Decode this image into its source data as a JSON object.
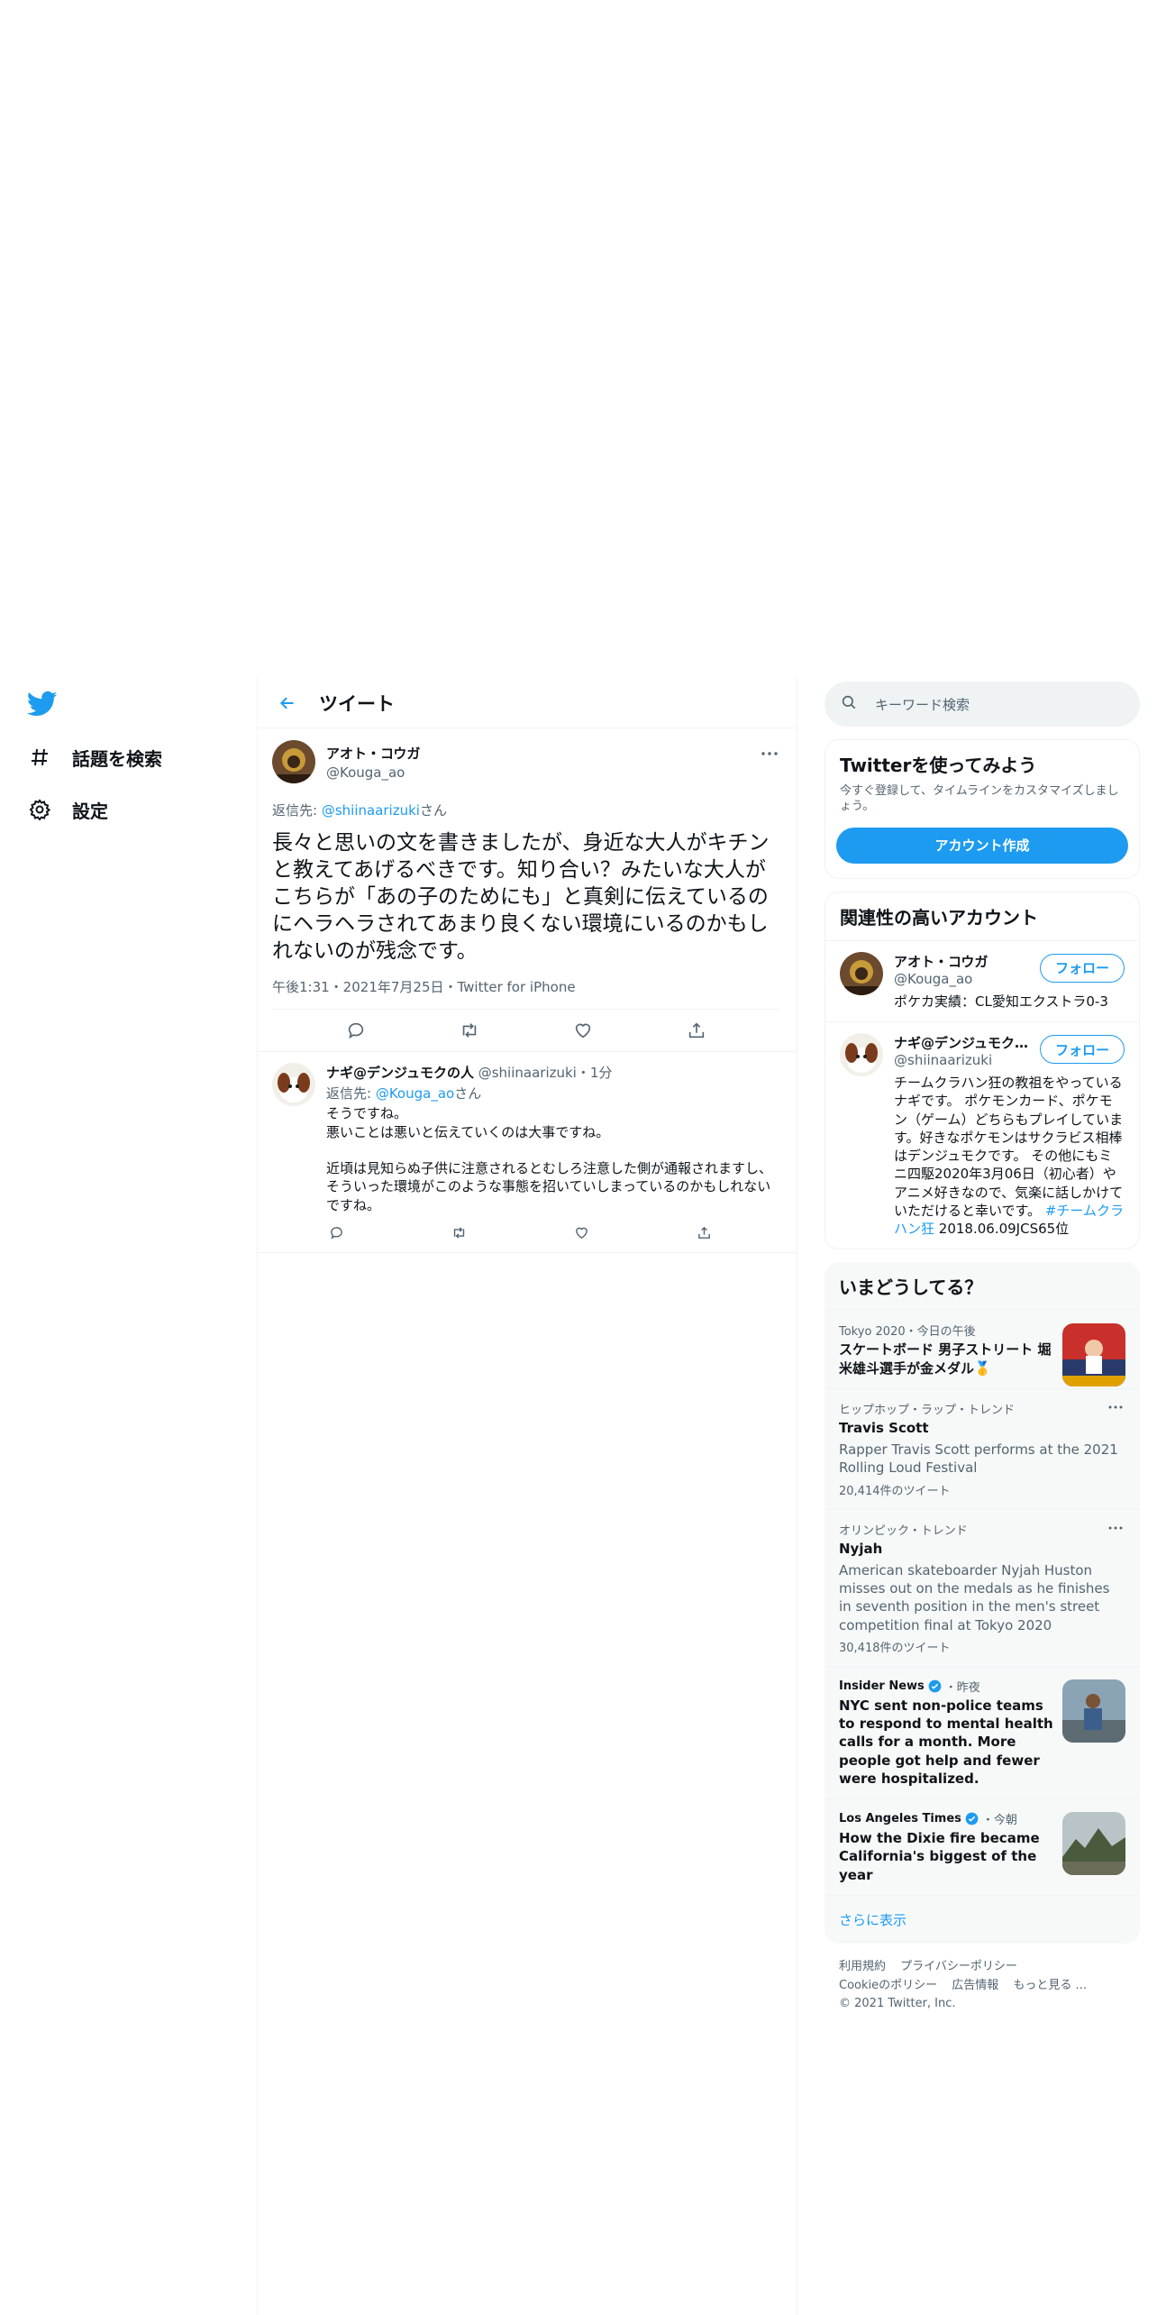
{
  "nav": {
    "items": [
      {
        "label": "話題を検索",
        "icon": "hashtag-icon"
      },
      {
        "label": "設定",
        "icon": "gear-icon"
      }
    ]
  },
  "header": {
    "title": "ツイート"
  },
  "main_tweet": {
    "display_name": "アオト・コウガ",
    "handle": "@Kouga_ao",
    "reply_prefix": "返信先: ",
    "reply_to": "@shiinaarizuki",
    "reply_suffix": "さん",
    "text": "長々と思いの文を書きましたが、身近な大人がキチンと教えてあげるべきです。知り合い？みたいな大人がこちらが「あの子のためにも」と真剣に伝えているのにヘラヘラされてあまり良くない環境にいるのかもしれないのが残念です。",
    "timestamp": "午後1:31・2021年7月25日・Twitter for iPhone"
  },
  "reply_tweet": {
    "display_name": "ナギ@デンジュモクの人",
    "handle": "@shiinaarizuki",
    "time": "・1分",
    "reply_prefix": "返信先: ",
    "reply_to": "@Kouga_ao",
    "reply_suffix": "さん",
    "text": "そうですね。\n悪いことは悪いと伝えていくのは大事ですね。\n\n近頃は見知らぬ子供に注意されるとむしろ注意した側が通報されますし、そういった環境がこのような事態を招いていしまっているのかもしれないですね。"
  },
  "search": {
    "placeholder": "キーワード検索"
  },
  "signup": {
    "title": "Twitterを使ってみよう",
    "subtitle": "今すぐ登録して、タイムラインをカスタマイズしましょう。",
    "button": "アカウント作成"
  },
  "relevant": {
    "title": "関連性の高いアカウント",
    "follow_label": "フォロー",
    "accounts": [
      {
        "display_name": "アオト・コウガ",
        "handle": "@Kouga_ao",
        "bio": "ポケカ実績：CL愛知エクストラ0-3"
      },
      {
        "display_name": "ナギ@デンジュモクの人",
        "handle": "@shiinaarizuki",
        "bio": "チームクラハン狂の教祖をやっているナギです。 ポケモンカード、ポケモン（ゲーム）どちらもプレイしています。好きなポケモンはサクラビス相棒はデンジュモクです。 その他にもミニ四駆2020年3月06日（初心者）やアニメ好きなので、気楽に話しかけていただけると幸いです。",
        "bio_tag": "#チームクラハン狂",
        "bio_tail": " 2018.06.09JCS65位"
      }
    ]
  },
  "trends": {
    "title": "いまどうしてる？",
    "items": [
      {
        "context": "Tokyo 2020・今日の午後",
        "headline": "スケートボード 男子ストリート 堀米雄斗選手が金メダル🥇"
      },
      {
        "context": "ヒップホップ・ラップ・トレンド",
        "headline": "Travis Scott",
        "desc": "Rapper Travis Scott performs at the 2021 Rolling Loud Festival",
        "count": "20,414件のツイート"
      },
      {
        "context": "オリンピック・トレンド",
        "headline": "Nyjah",
        "desc": "American skateboarder Nyjah Huston misses out on the medals as he finishes in seventh position in the men's street competition final at Tokyo 2020",
        "count": "30,418件のツイート"
      },
      {
        "source": "Insider News",
        "time": "・昨夜",
        "headline": "NYC sent non-police teams to respond to mental health calls for a month. More people got help and fewer were hospitalized."
      },
      {
        "source": "Los Angeles Times",
        "time": "・今朝",
        "headline": "How the Dixie fire became California's biggest of the year"
      }
    ],
    "show_more": "さらに表示"
  },
  "footer": {
    "links": [
      "利用規約",
      "プライバシーポリシー",
      "Cookieのポリシー",
      "広告情報",
      "もっと見る ..."
    ],
    "copyright": "© 2021 Twitter, Inc."
  },
  "colors": {
    "accent": "#1d9bf0",
    "text": "#0f1419",
    "muted": "#536471",
    "border": "#eff3f4"
  }
}
